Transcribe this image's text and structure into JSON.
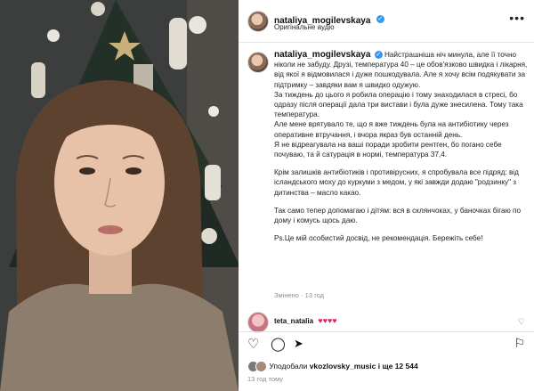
{
  "post": {
    "author": "nataliya_mogilevskaya",
    "audio_label": "Оригінальне аудіо",
    "more_icon": "more-horizontal-icon"
  },
  "caption": {
    "author": "nataliya_mogilevskaya",
    "paragraphs": [
      "Найстрашніша ніч минула, але її точно ніколи не забуду. Друзі, температура 40 – це обов'язково швидка і лікарня, від якої я відмовилася і дуже пошкодувала. Але я хочу всім подякувати за підтримку – завдяки вам я швидко одужую.",
      "За тиждень до цього я робила операцію і тому знаходилася в стресі, бо одразу після операції дала три вистави і була дуже знесилена. Тому така температура.",
      "Але мене врятувало те, що я вже тиждень була на антибіотику через оперативне втручання, і вчора якраз був останній день.",
      "Я не відреагувала на ваші поради зробити рентген, бо погано себе почуваю, та й сатурація в нормі, температура 37,4.",
      "",
      "Крім залишків антибіотиків і противірусних, я спробувала все підряд: від ісландського моху до куркуми з медом, у які завжди додаю \"родзинку\" з дитинства – масло какао.",
      "",
      "Так само тепер допомагаю і дітям: вся в склянчоках, у баночках бігаю по дому і комусь щось даю.",
      "",
      "Ps.Це мій особистий досвід, не рекомендація. Бережіть себе!"
    ],
    "meta": "Змінено · 13 год"
  },
  "comment": {
    "author": "teta_natalia",
    "text": "♥♥♥♥"
  },
  "likes": {
    "prefix": "Уподобали ",
    "user": "vkozlovsky_music",
    "suffix": " і ще 12 544"
  },
  "date": "13 год тому",
  "colors": {
    "verified": "#3897f0",
    "muted": "#8e8e8e",
    "hearts": "#e0245e"
  }
}
